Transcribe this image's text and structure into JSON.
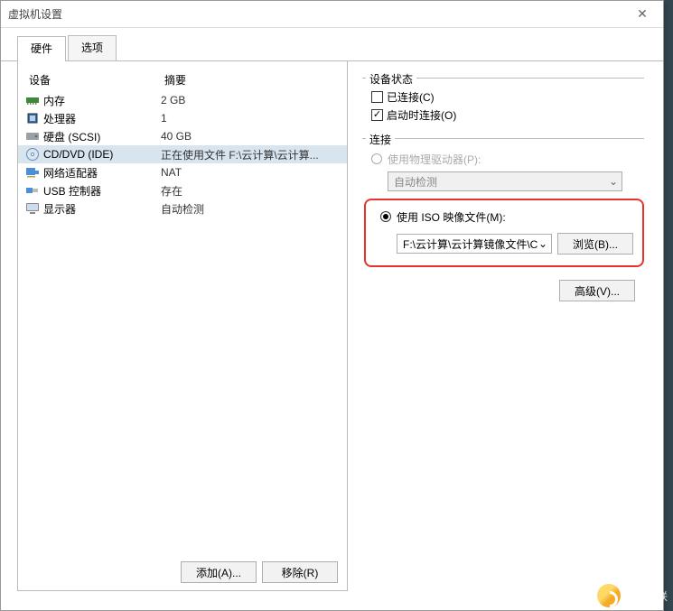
{
  "window": {
    "title": "虚拟机设置"
  },
  "tabs": {
    "hardware": "硬件",
    "options": "选项"
  },
  "headers": {
    "device": "设备",
    "summary": "摘要"
  },
  "devices": [
    {
      "icon": "memory-icon",
      "name": "内存",
      "summary": "2 GB"
    },
    {
      "icon": "cpu-icon",
      "name": "处理器",
      "summary": "1"
    },
    {
      "icon": "hdd-icon",
      "name": "硬盘 (SCSI)",
      "summary": "40 GB"
    },
    {
      "icon": "disc-icon",
      "name": "CD/DVD (IDE)",
      "summary": "正在使用文件 F:\\云计算\\云计算..."
    },
    {
      "icon": "nic-icon",
      "name": "网络适配器",
      "summary": "NAT"
    },
    {
      "icon": "usb-icon",
      "name": "USB 控制器",
      "summary": "存在"
    },
    {
      "icon": "display-icon",
      "name": "显示器",
      "summary": "自动检测"
    }
  ],
  "left_buttons": {
    "add": "添加(A)...",
    "remove": "移除(R)"
  },
  "status": {
    "legend": "设备状态",
    "connected": "已连接(C)",
    "connect_at_poweron": "启动时连接(O)"
  },
  "connection": {
    "legend": "连接",
    "use_physical": "使用物理驱动器(P):",
    "auto_detect": "自动检测",
    "use_iso": "使用 ISO 映像文件(M):",
    "iso_value": "F:\\云计算\\云计算镜像文件\\C",
    "browse": "浏览(B)..."
  },
  "advanced": "高级(V)...",
  "brand": "创新互联"
}
